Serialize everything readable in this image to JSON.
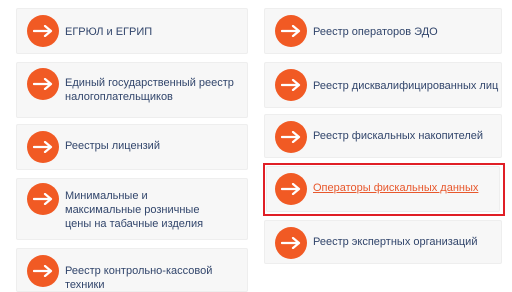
{
  "left_column": [
    {
      "label": "ЕГРЮЛ и ЕГРИП"
    },
    {
      "label": "Единый государственный реестр налогоплательщиков"
    },
    {
      "label": "Реестры лицензий"
    },
    {
      "label": "Минимальные и максимальные розничные цены на табачные изделия"
    },
    {
      "label": "Реестр контрольно-кассовой техники"
    }
  ],
  "right_column": [
    {
      "label": "Реестр операторов ЭДО"
    },
    {
      "label": "Реестр дисквалифицированных лиц"
    },
    {
      "label": "Реестр фискальных накопителей"
    },
    {
      "label": "Операторы фискальных данных"
    },
    {
      "label": "Реестр экспертных организаций"
    }
  ],
  "highlighted_item": "Операторы фискальных данных",
  "colors": {
    "icon": "#f15a24",
    "link": "#31456b",
    "active_link": "#e8582d",
    "highlight_border": "#e01f26"
  },
  "icon_name": "arrow-right-icon"
}
